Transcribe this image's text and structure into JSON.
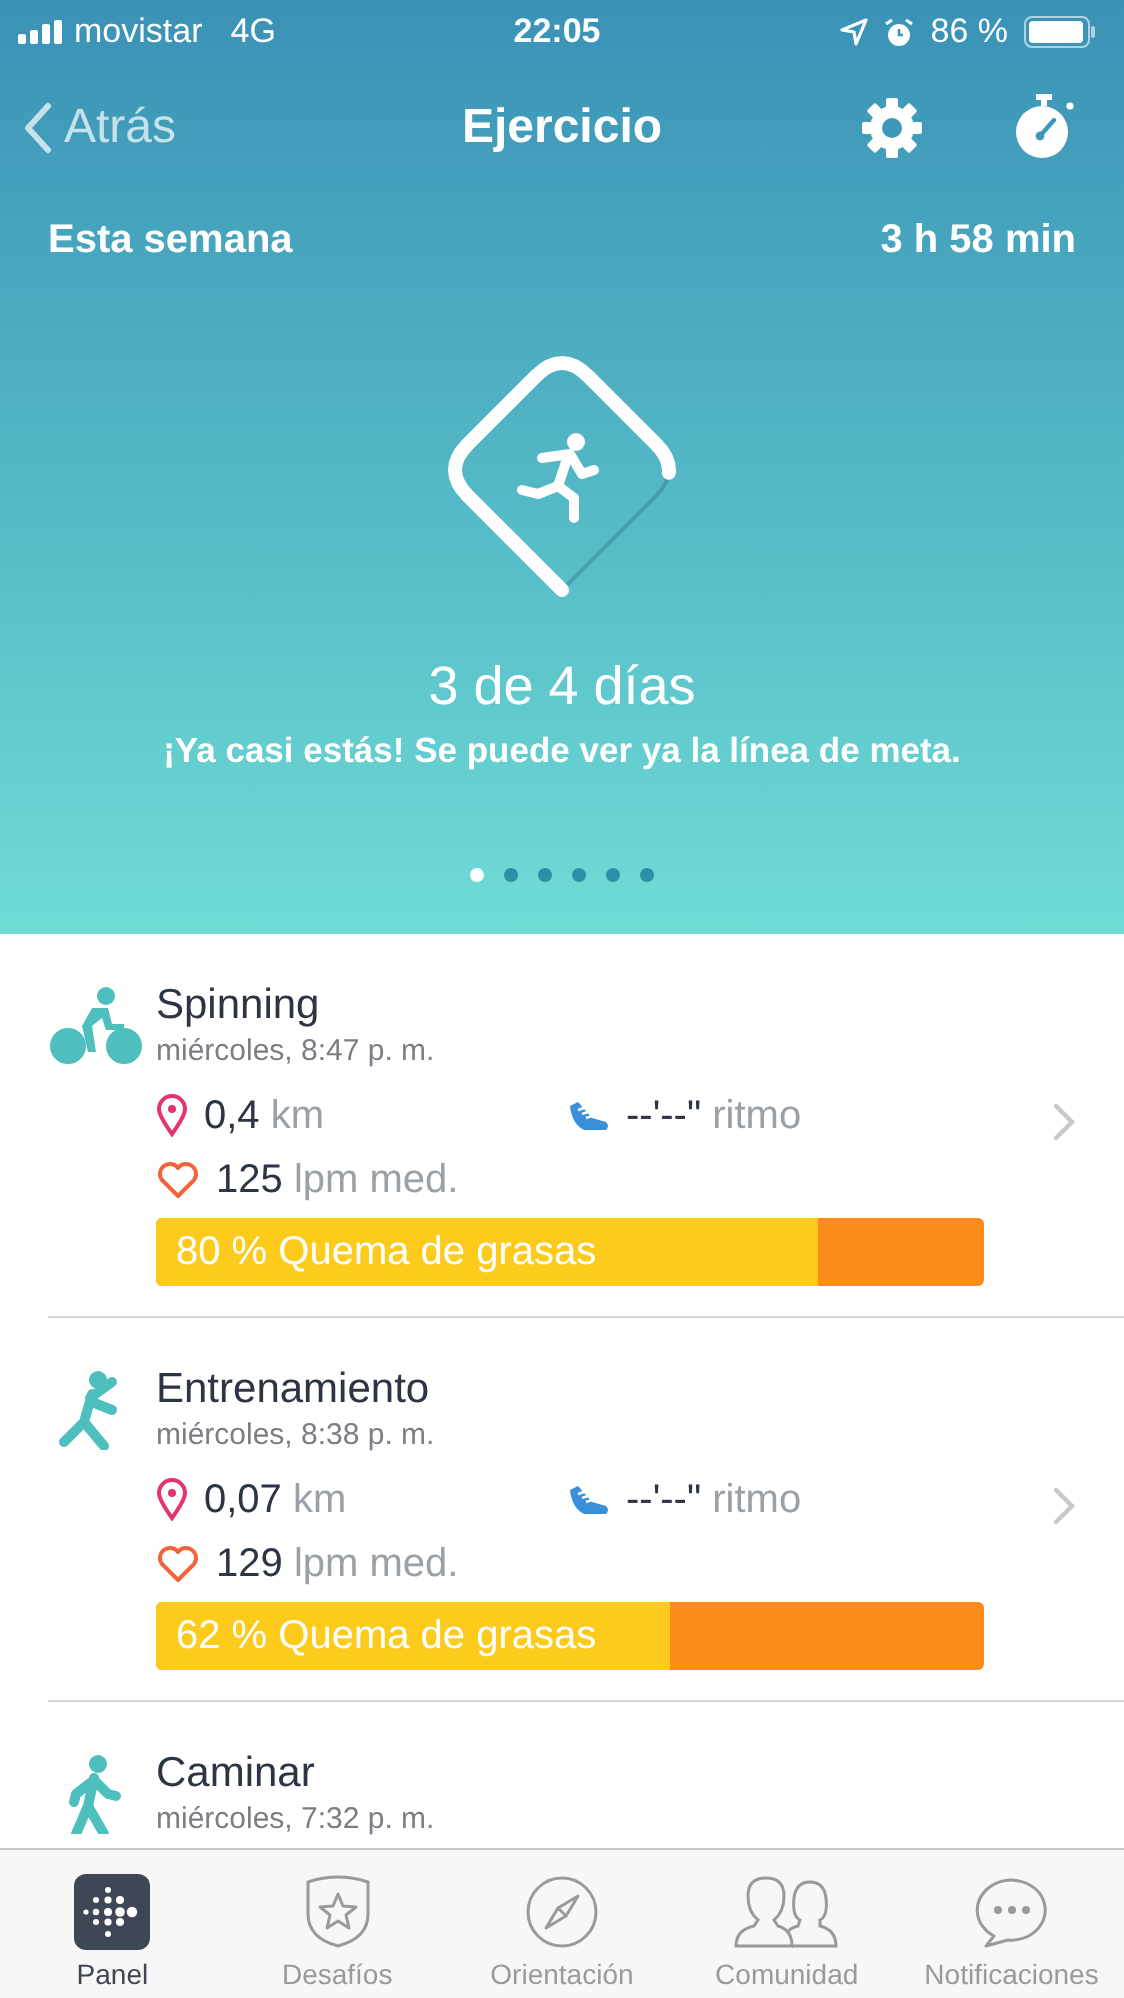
{
  "status_bar": {
    "carrier": "movistar",
    "network": "4G",
    "time": "22:05",
    "battery": "86 %"
  },
  "nav": {
    "back": "Atrás",
    "title": "Ejercicio"
  },
  "summary": {
    "label": "Esta semana",
    "total": "3 h 58 min"
  },
  "goal": {
    "text": "3 de 4 días",
    "message": "¡Ya casi estás! Se puede ver ya la línea de meta."
  },
  "pager": [
    {
      "selected": true
    },
    {
      "selected": false
    },
    {
      "selected": false
    },
    {
      "selected": false
    },
    {
      "selected": false
    },
    {
      "selected": false
    }
  ],
  "workouts": [
    {
      "kind": "bike",
      "name": "Spinning",
      "date": "miércoles, 8:47 p. m.",
      "distance": "0,4",
      "distance_unit": "km",
      "pace": "--'--\"",
      "pace_unit": "ritmo",
      "heart": "125",
      "heart_unit": "lpm med.",
      "zone": "80 % Quema de grasas",
      "level": 0.8
    },
    {
      "kind": "stretch",
      "name": "Entrenamiento",
      "date": "miércoles, 8:38 p. m.",
      "distance": "0,07",
      "distance_unit": "km",
      "pace": "--'--\"",
      "pace_unit": "ritmo",
      "heart": "129",
      "heart_unit": "lpm med.",
      "zone": "62 % Quema de grasas",
      "level": 0.62
    },
    {
      "kind": "walk",
      "name": "Caminar",
      "date": "miércoles, 7:32 p. m."
    }
  ],
  "tabs": [
    {
      "kind": "panel",
      "label": "Panel",
      "selected": true
    },
    {
      "kind": "challenges",
      "label": "Desafíos",
      "selected": false
    },
    {
      "kind": "guidance",
      "label": "Orientación",
      "selected": false
    },
    {
      "kind": "community",
      "label": "Comunidad",
      "selected": false
    },
    {
      "kind": "notifications",
      "label": "Notificaciones",
      "selected": false
    }
  ]
}
